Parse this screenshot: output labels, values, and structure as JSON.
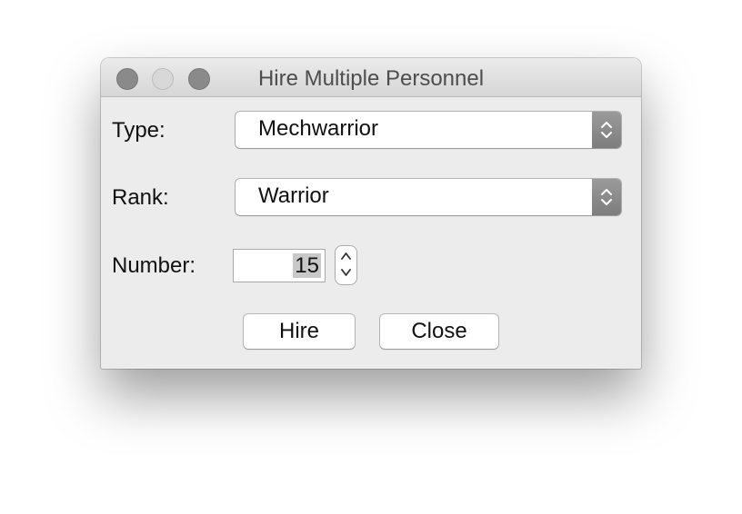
{
  "window": {
    "title": "Hire Multiple Personnel"
  },
  "form": {
    "type_label": "Type:",
    "type_value": "Mechwarrior",
    "rank_label": "Rank:",
    "rank_value": "Warrior",
    "number_label": "Number:",
    "number_value": "15"
  },
  "buttons": {
    "hire": "Hire",
    "close": "Close"
  },
  "icons": {
    "traffic_lights": [
      "close-icon",
      "minimize-icon",
      "zoom-icon"
    ],
    "combo_arrow": "updown-chevron-icon",
    "stepper_up": "chevron-up-icon",
    "stepper_down": "chevron-down-icon"
  },
  "colors": {
    "window_bg": "#ececec",
    "combo_arrow_bg": "#8a8a8a",
    "selection_bg": "#c8c8c8"
  }
}
